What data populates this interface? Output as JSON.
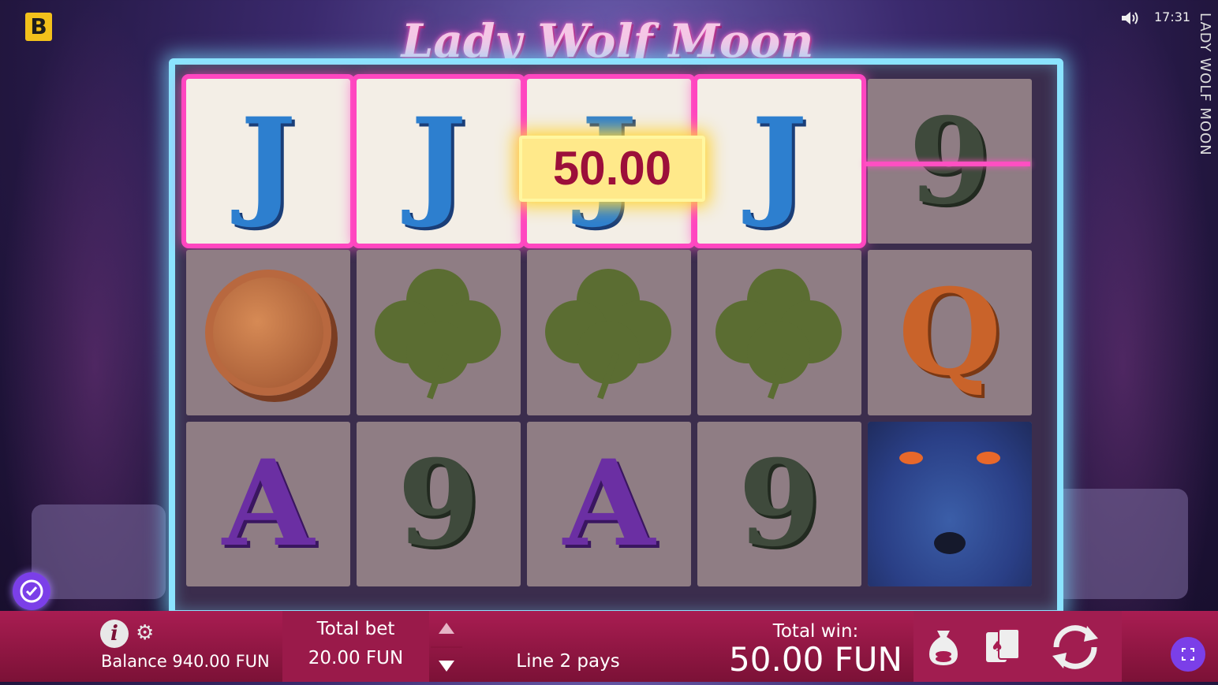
{
  "game": {
    "title": "Lady Wolf Moon",
    "side_title": "LADY WOLF MOON",
    "brand_letter": "B",
    "clock": "17:31"
  },
  "reels": {
    "rows": [
      [
        {
          "symbol": "J",
          "kind": "j",
          "win": true
        },
        {
          "symbol": "J",
          "kind": "j",
          "win": true
        },
        {
          "symbol": "J",
          "kind": "j",
          "win": true
        },
        {
          "symbol": "J",
          "kind": "j",
          "win": true
        },
        {
          "symbol": "9",
          "kind": "nine",
          "win": false
        }
      ],
      [
        {
          "symbol": "coin",
          "kind": "coin",
          "win": false
        },
        {
          "symbol": "clover",
          "kind": "clover",
          "win": false
        },
        {
          "symbol": "clover",
          "kind": "clover",
          "win": false
        },
        {
          "symbol": "clover",
          "kind": "clover",
          "win": false
        },
        {
          "symbol": "Q",
          "kind": "q",
          "win": false
        }
      ],
      [
        {
          "symbol": "A",
          "kind": "a",
          "win": false
        },
        {
          "symbol": "9",
          "kind": "nine",
          "win": false
        },
        {
          "symbol": "A",
          "kind": "a",
          "win": false
        },
        {
          "symbol": "9",
          "kind": "nine",
          "win": false
        },
        {
          "symbol": "wolf",
          "kind": "wolf",
          "win": false
        }
      ]
    ],
    "win_amount": "50.00"
  },
  "footer": {
    "balance": "Balance 940.00 FUN",
    "total_bet_label": "Total bet",
    "total_bet_value": "20.00 FUN",
    "line_pays": "Line 2 pays",
    "total_win_label": "Total win:",
    "total_win_value": "50.00 FUN"
  },
  "colors": {
    "frame": "#8be4ff",
    "win_highlight": "#ff46c0",
    "footer": "#a91d52"
  }
}
